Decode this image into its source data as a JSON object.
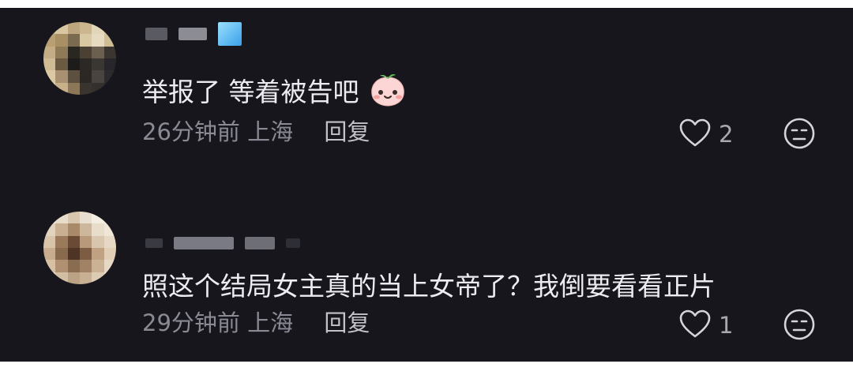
{
  "comments": [
    {
      "text": "举报了 等着被告吧",
      "emoji": "peach-face-emoji",
      "time": "26分钟前",
      "location": "上海",
      "reply_label": "回复",
      "likes": "2"
    },
    {
      "text": "照这个结局女主真的当上女帝了？我倒要看看正片",
      "time": "29分钟前",
      "location": "上海",
      "reply_label": "回复",
      "likes": "1"
    }
  ],
  "colors": {
    "background": "#16161c",
    "text": "#ececf0",
    "meta": "#8a8a94",
    "icon": "#d4d4da"
  },
  "icons": [
    "heart-icon",
    "meh-face-icon",
    "peach-face-emoji"
  ]
}
